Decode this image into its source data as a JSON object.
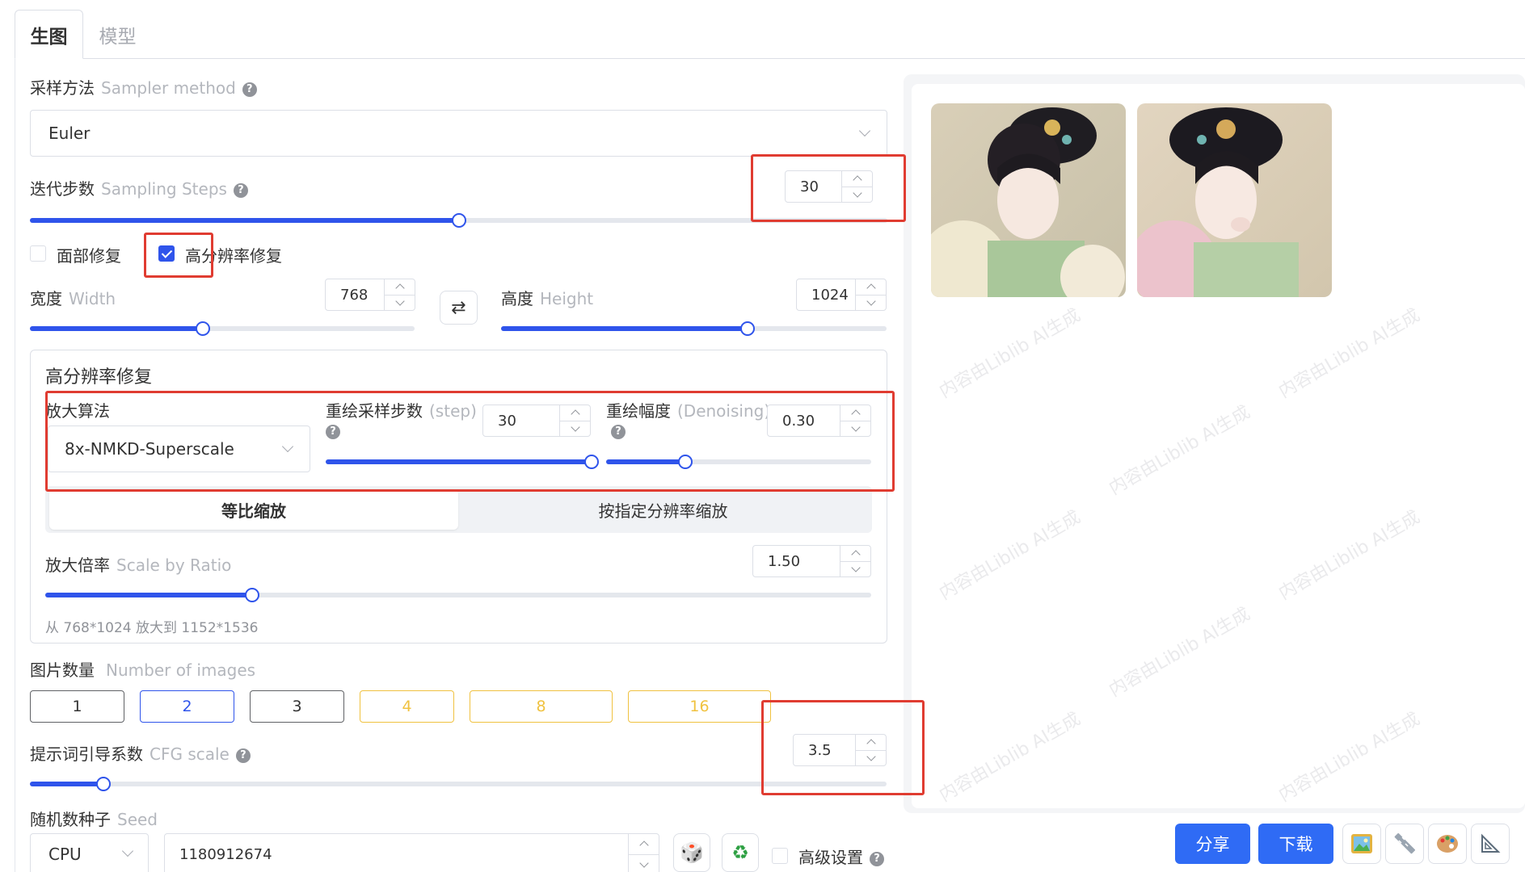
{
  "tabs": {
    "generate": "生图",
    "model": "模型"
  },
  "sampler": {
    "label_cn": "采样方法",
    "label_en": "Sampler method",
    "value": "Euler"
  },
  "steps": {
    "label_cn": "迭代步数",
    "label_en": "Sampling Steps",
    "value": "30",
    "slider_fraction": 0.5
  },
  "checks": {
    "face_fix": "面部修复",
    "face_fix_checked": false,
    "hires_fix": "高分辨率修复",
    "hires_fix_checked": true
  },
  "width": {
    "label_cn": "宽度",
    "label_en": "Width",
    "value": "768",
    "slider_fraction": 0.45
  },
  "height": {
    "label_cn": "高度",
    "label_en": "Height",
    "value": "1024",
    "slider_fraction": 0.64
  },
  "swap_icon": "swap-arrows-icon",
  "hires": {
    "title": "高分辨率修复",
    "upscaler_label": "放大算法",
    "upscaler_value": "8x-NMKD-Superscale",
    "hr_steps_label_cn": "重绘采样步数",
    "hr_steps_label_en": "(step)",
    "hr_steps_value": "30",
    "hr_steps_fraction": 1.0,
    "denoise_label_cn": "重绘幅度",
    "denoise_label_en": "(Denoising)",
    "denoise_value": "0.30",
    "denoise_fraction": 0.3,
    "mode_ratio": "等比缩放",
    "mode_resolution": "按指定分辨率缩放",
    "scale_label_cn": "放大倍率",
    "scale_label_en": "Scale by Ratio",
    "scale_value": "1.50",
    "scale_fraction": 0.25,
    "hint": "从 768*1024 放大到 1152*1536"
  },
  "images": {
    "label_cn": "图片数量",
    "label_en": "Number of images",
    "options": [
      "1",
      "2",
      "3",
      "4",
      "8",
      "16"
    ],
    "selected": "2"
  },
  "cfg": {
    "label_cn": "提示词引导系数",
    "label_en": "CFG scale",
    "value": "3.5",
    "slider_fraction": 0.086
  },
  "seed": {
    "label_cn": "随机数种子",
    "label_en": "Seed",
    "device": "CPU",
    "value": "1180912674",
    "advanced_label": "高级设置"
  },
  "preview": {
    "watermark": "内容由Liblib AI生成"
  },
  "actions": {
    "share": "分享",
    "download": "下载"
  },
  "colors": {
    "accent": "#2f54eb",
    "red_highlight": "#e03c31",
    "gold": "#f0c240",
    "action_blue": "#2f6bf5"
  }
}
